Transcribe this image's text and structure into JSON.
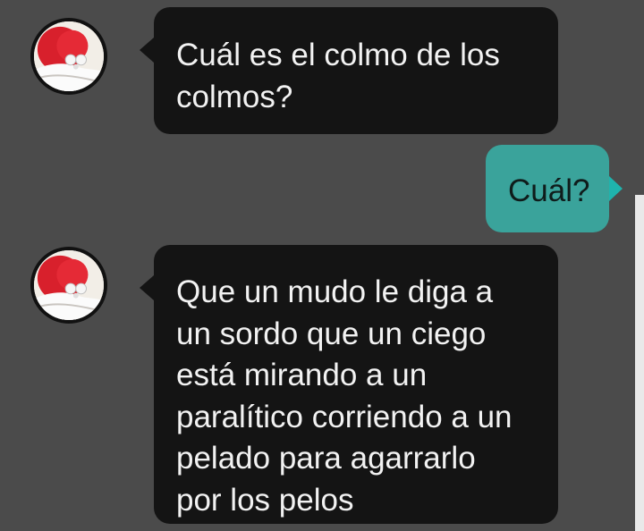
{
  "messages": [
    {
      "sender": "other",
      "avatar_icon": "red-hat-santa-avatar-icon",
      "text": "Cuál es el colmo de los\ncolmos?"
    },
    {
      "sender": "me",
      "text": "Cuál?"
    },
    {
      "sender": "other",
      "avatar_icon": "red-hat-santa-avatar-icon",
      "text": "Que un mudo le diga a\nun sordo que un ciego\nestá mirando a un\nparalítico corriendo a un\npelado para  agarrarlo\npor los pelos"
    }
  ],
  "colors": {
    "background": "#4b4b4b",
    "incoming_bubble": "#141414",
    "outgoing_bubble": "#3aa39b",
    "outgoing_tail": "#1fb3ad",
    "incoming_text": "#f2f2f2",
    "outgoing_text": "#0f1c1b"
  }
}
